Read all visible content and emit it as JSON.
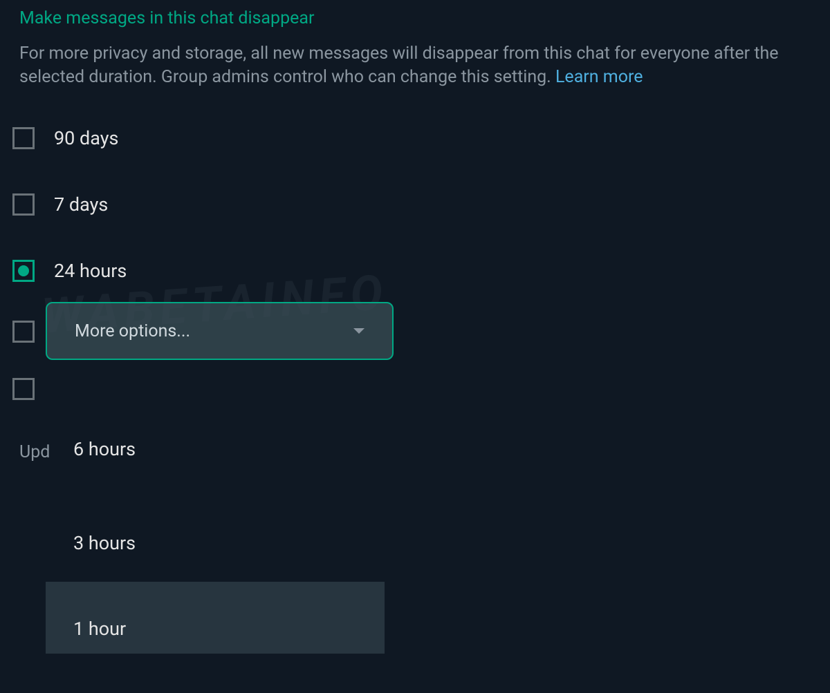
{
  "header": {
    "title": "Make messages in this chat disappear"
  },
  "description": {
    "text_before_link": "For more privacy and storage, all new messages will disappear from this chat for everyone after the selected duration. Group admins control who can change this setting. ",
    "link_text": "Learn more"
  },
  "options": [
    {
      "label": "90 days",
      "selected": false
    },
    {
      "label": "7 days",
      "selected": false
    },
    {
      "label": "24 hours",
      "selected": true
    }
  ],
  "dropdown": {
    "label": "More options..."
  },
  "dropdown_menu": {
    "items": [
      {
        "label": "6 hours",
        "highlighted": false
      },
      {
        "label": "3 hours",
        "highlighted": false
      },
      {
        "label": "1 hour",
        "highlighted": true
      }
    ]
  },
  "partial_text": "Upd",
  "watermark": "WABETAINFO"
}
